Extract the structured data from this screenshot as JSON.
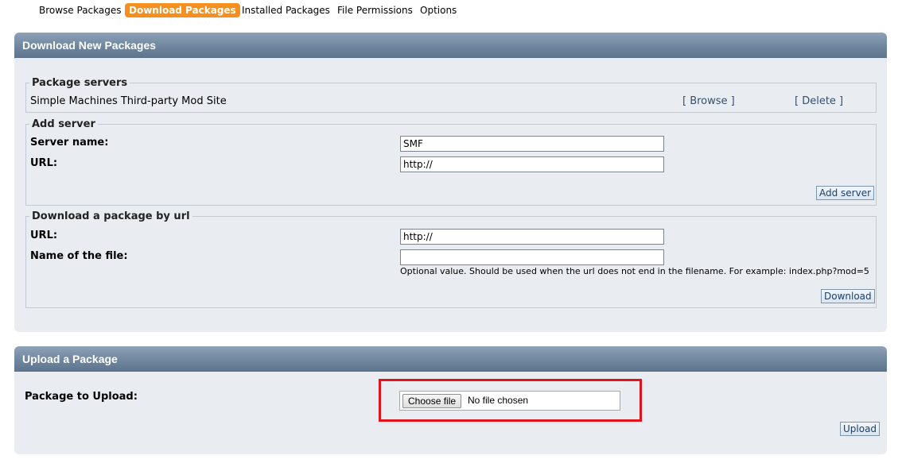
{
  "tabs": [
    {
      "label": "Browse Packages",
      "active": false
    },
    {
      "label": "Download Packages",
      "active": true
    },
    {
      "label": "Installed Packages",
      "active": false
    },
    {
      "label": "File Permissions",
      "active": false
    },
    {
      "label": "Options",
      "active": false
    }
  ],
  "download_section": {
    "title": "Download New Packages",
    "package_servers": {
      "legend": "Package servers",
      "server_name": "Simple Machines Third-party Mod Site",
      "browse_link": "[ Browse ]",
      "delete_link": "[ Delete ]"
    },
    "add_server": {
      "legend": "Add server",
      "name_label": "Server name:",
      "name_value": "SMF",
      "url_label": "URL:",
      "url_value": "http://",
      "button": "Add server"
    },
    "download_by_url": {
      "legend": "Download a package by url",
      "url_label": "URL:",
      "url_value": "http://",
      "filename_label": "Name of the file:",
      "filename_value": "",
      "note": "Optional value. Should be used when the url does not end in the filename. For example: index.php?mod=5",
      "button": "Download"
    }
  },
  "upload_section": {
    "title": "Upload a Package",
    "label": "Package to Upload:",
    "choose_button": "Choose file",
    "no_file_text": "No file chosen",
    "button": "Upload"
  },
  "colors": {
    "active_tab": "#f5901e",
    "header": "#6f869e",
    "panel": "#e9edf1",
    "highlight": "#e0141e"
  }
}
